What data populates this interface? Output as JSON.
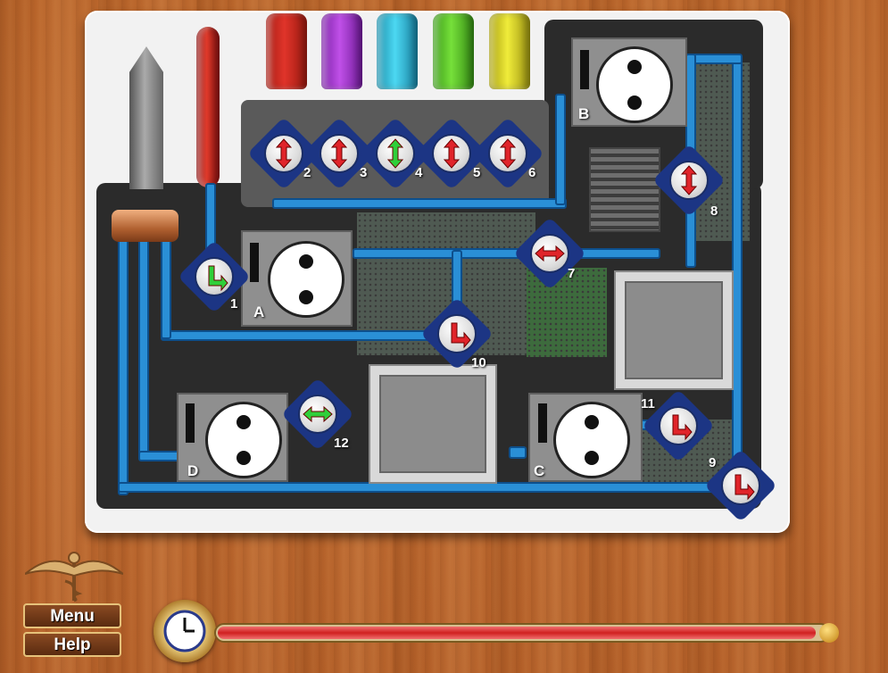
{
  "menu": {
    "menu_label": "Menu",
    "help_label": "Help"
  },
  "pumps": [
    {
      "label": "A"
    },
    {
      "label": "B"
    },
    {
      "label": "C"
    },
    {
      "label": "D"
    }
  ],
  "valves": [
    {
      "num": "1",
      "color": "#2fcf3a"
    },
    {
      "num": "2",
      "color": "#e0242a"
    },
    {
      "num": "3",
      "color": "#e0242a"
    },
    {
      "num": "4",
      "color": "#2fcf3a"
    },
    {
      "num": "5",
      "color": "#e0242a"
    },
    {
      "num": "6",
      "color": "#e0242a"
    },
    {
      "num": "7",
      "color": "#e0242a"
    },
    {
      "num": "8",
      "color": "#e0242a"
    },
    {
      "num": "9",
      "color": "#e0242a"
    },
    {
      "num": "10",
      "color": "#e0242a"
    },
    {
      "num": "11",
      "color": "#e0242a"
    },
    {
      "num": "12",
      "color": "#2fcf3a"
    }
  ],
  "fluid_tubes": [
    {
      "name": "red",
      "color": "#e0342a"
    },
    {
      "name": "purple",
      "color": "#b040d8"
    },
    {
      "name": "cyan",
      "color": "#38c8e8"
    },
    {
      "name": "green",
      "color": "#6ad030"
    },
    {
      "name": "yellow",
      "color": "#e8e030"
    }
  ],
  "timer": {
    "icon": "clock-icon",
    "remaining_fraction": 1.0,
    "bar_color": "#e04040"
  },
  "colors": {
    "pipe": "#2a8fd6",
    "valve_base": "#1c3584",
    "wood": "#b8642a"
  }
}
